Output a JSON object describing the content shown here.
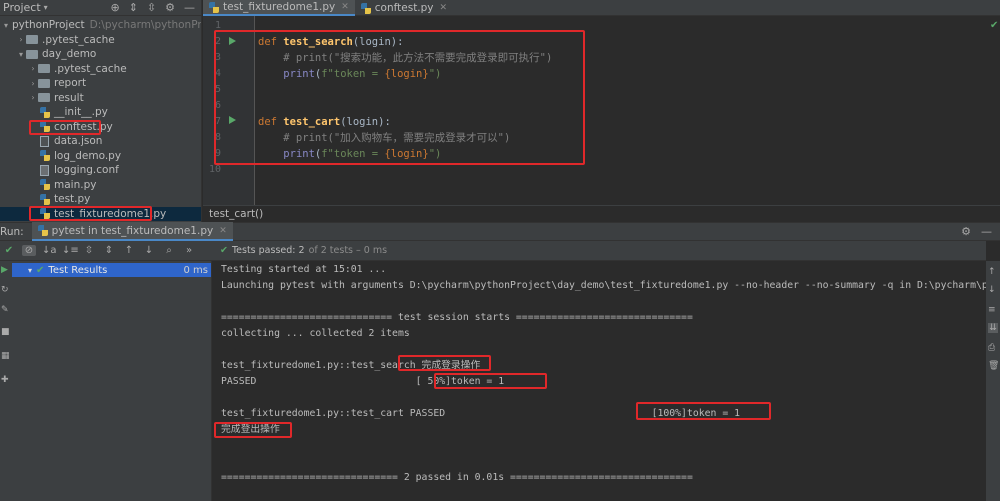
{
  "project_panel": {
    "title": "Project",
    "tree": [
      {
        "label": "pythonProject",
        "hint": "D:\\pycharm\\pythonProject",
        "kind": "folder",
        "depth": 0,
        "expanded": true
      },
      {
        "label": ".pytest_cache",
        "kind": "folder",
        "depth": 1,
        "expanded": false
      },
      {
        "label": "day_demo",
        "kind": "folder",
        "depth": 1,
        "expanded": true
      },
      {
        "label": ".pytest_cache",
        "kind": "folder",
        "depth": 2,
        "expanded": false
      },
      {
        "label": "report",
        "kind": "folder",
        "depth": 2,
        "expanded": false
      },
      {
        "label": "result",
        "kind": "folder",
        "depth": 2,
        "expanded": false
      },
      {
        "label": "__init__.py",
        "kind": "py",
        "depth": 3
      },
      {
        "label": "conftest.py",
        "kind": "py",
        "depth": 3
      },
      {
        "label": "data.json",
        "kind": "json",
        "depth": 3
      },
      {
        "label": "log_demo.py",
        "kind": "py",
        "depth": 3
      },
      {
        "label": "logging.conf",
        "kind": "conf",
        "depth": 3
      },
      {
        "label": "main.py",
        "kind": "py",
        "depth": 3
      },
      {
        "label": "test.py",
        "kind": "py",
        "depth": 3
      },
      {
        "label": "test_fixturedome1.py",
        "kind": "py",
        "depth": 3,
        "selected": true
      }
    ]
  },
  "editor": {
    "tabs": [
      {
        "label": "test_fixturedome1.py",
        "active": true
      },
      {
        "label": "conftest.py",
        "active": false
      }
    ],
    "line_numbers": [
      "1",
      "2",
      "3",
      "4",
      "5",
      "6",
      "7",
      "8",
      "9",
      "10"
    ],
    "code": {
      "l2_def": "def ",
      "l2_name": "test_search",
      "l2_rest": "(login):",
      "l3": "    # print(\"搜索功能，此方法不需要完成登录即可执行\")",
      "l4_print": "print",
      "l4_open": "(",
      "l4_f": "f\"token = ",
      "l4_brace": "{login}",
      "l4_close": "\")",
      "l7_def": "def ",
      "l7_name": "test_cart",
      "l7_rest": "(login):",
      "l8": "    # print(\"加入购物车，需要完成登录才可以\")",
      "l9_print": "print",
      "l9_open": "(",
      "l9_f": "f\"token = ",
      "l9_brace": "{login}",
      "l9_close": "\")"
    },
    "breadcrumb": "test_cart()"
  },
  "run_panel": {
    "label": "Run:",
    "tab_label": "pytest in test_fixturedome1.py",
    "status_prefix": "Tests passed:",
    "status_count": "2",
    "status_suffix": "of 2 tests – 0 ms",
    "test_results_label": "Test Results",
    "test_results_duration": "0 ms",
    "console_lines": [
      "Testing started at 15:01 ...",
      "Launching pytest with arguments D:\\pycharm\\pythonProject\\day_demo\\test_fixturedome1.py --no-header --no-summary -q in D:\\pycharm\\pyt",
      "",
      "============================= test session starts ==============================",
      "collecting ... collected 2 items",
      "",
      "test_fixturedome1.py::test_search 完成登录操作",
      "PASSED                           [ 50%]token = 1",
      "",
      "test_fixturedome1.py::test_cart PASSED                                   [100%]token = 1",
      "完成登出操作",
      "",
      "",
      "============================== 2 passed in 0.01s ==============================="
    ]
  }
}
